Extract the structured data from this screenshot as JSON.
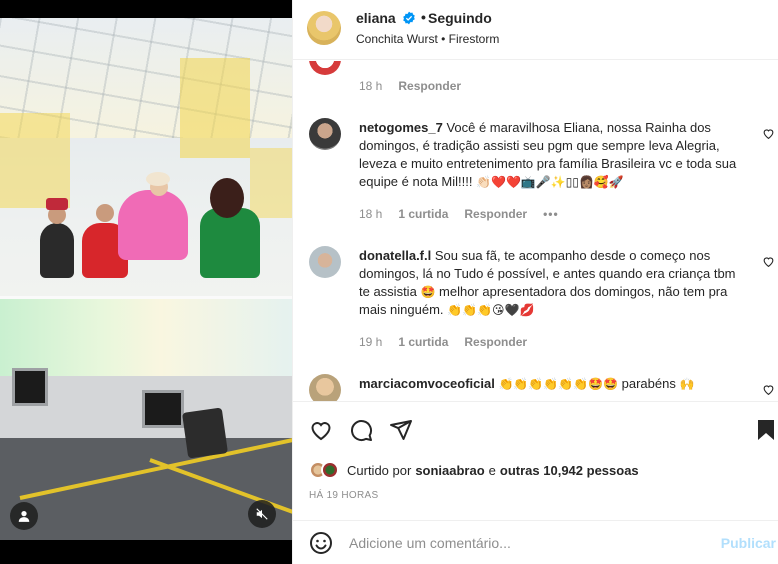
{
  "post": {
    "username": "eliana",
    "follow_state": "Seguindo",
    "audio": "Conchita Wurst • Firestorm",
    "verified_color": "#0095f6"
  },
  "comments": [
    {
      "meta": {
        "time": "18 h",
        "reply": "Responder"
      }
    },
    {
      "user": "netogomes_7",
      "text": "Você é maravilhosa Eliana, nossa Rainha dos domingos, é tradição assisti seu pgm que sempre leva Alegria, leveza e muito entretenimento pra família Brasileira vc e toda sua equipe é nota Mil!!!!",
      "emojis": "👏🏻❤️❤️📺🎤✨▯▯👩🏽🥰🚀",
      "time": "18 h",
      "likes": "1 curtida",
      "reply": "Responder",
      "more": "•••"
    },
    {
      "user": "donatella.f.l",
      "text_a": "Sou sua fã, te acompanho desde o começo nos domingos, lá no Tudo é possível, e antes quando era criança tbm te assistia",
      "emoji_a": "🤩",
      "text_b": "melhor apresentadora dos domingos, não tem pra mais ninguém.",
      "emojis": "👏👏👏😘🖤💋",
      "time": "19 h",
      "likes": "1 curtida",
      "reply": "Responder"
    },
    {
      "user": "marciacomvoceoficial",
      "emojis": "👏👏👏👏👏👏🤩🤩",
      "text": "parabéns",
      "emoji_end": "🙌"
    }
  ],
  "likes": {
    "prefix": "Curtido por",
    "user": "soniaabrao",
    "connector": "e",
    "others": "outras 10,942 pessoas"
  },
  "time_ago": "HÁ 19 HORAS",
  "add_comment": {
    "placeholder": "Adicione um comentário...",
    "publish": "Publicar"
  },
  "icons": {
    "heart": "heart-icon",
    "comment": "comment-icon",
    "share": "share-icon",
    "save": "bookmark-icon",
    "emoji": "emoji-icon",
    "mute": "muted-speaker-icon",
    "user": "user-tag-icon"
  }
}
